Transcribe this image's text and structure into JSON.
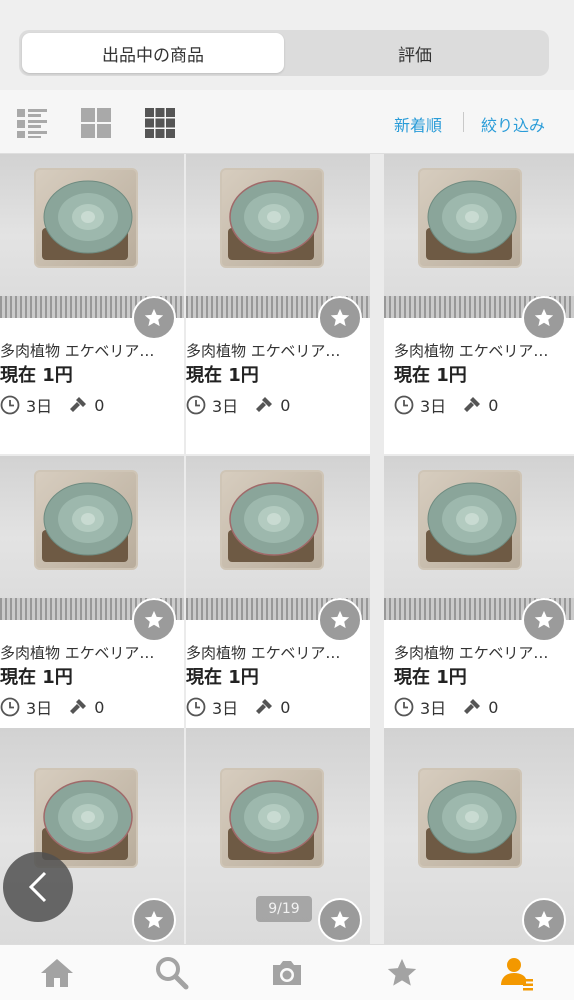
{
  "tabs": [
    {
      "label": "出品中の商品",
      "active": true
    },
    {
      "label": "評価",
      "active": false
    }
  ],
  "toolbar": {
    "view_modes": [
      "list-view-icon",
      "grid-2-icon",
      "grid-3-icon"
    ],
    "sort_label": "新着順",
    "filter_label": "絞り込み",
    "accent_color": "#2a9cd8"
  },
  "items": [
    {
      "title": "多肉植物 エケベリア…",
      "price": "現在 1円",
      "time_left": "3日",
      "bids": "0"
    },
    {
      "title": "多肉植物 エケベリア…",
      "price": "現在 1円",
      "time_left": "3日",
      "bids": "0"
    },
    {
      "title": "多肉植物 エケベリア…",
      "price": "現在 1円",
      "time_left": "3日",
      "bids": "0"
    },
    {
      "title": "多肉植物 エケベリア…",
      "price": "現在 1円",
      "time_left": "3日",
      "bids": "0"
    },
    {
      "title": "多肉植物 エケベリア…",
      "price": "現在 1円",
      "time_left": "3日",
      "bids": "0"
    },
    {
      "title": "多肉植物 エケベリア…",
      "price": "現在 1円",
      "time_left": "3日",
      "bids": "0"
    },
    {
      "title": "",
      "price": "",
      "time_left": "",
      "bids": ""
    },
    {
      "title": "",
      "price": "",
      "time_left": "",
      "bids": ""
    },
    {
      "title": "",
      "price": "",
      "time_left": "",
      "bids": ""
    }
  ],
  "pager": {
    "text": "9/19"
  },
  "bottom_nav": [
    {
      "icon": "home-icon"
    },
    {
      "icon": "search-icon"
    },
    {
      "icon": "camera-icon"
    },
    {
      "icon": "star-icon"
    },
    {
      "icon": "my-page-icon",
      "active": true,
      "active_color": "#f39800"
    }
  ]
}
